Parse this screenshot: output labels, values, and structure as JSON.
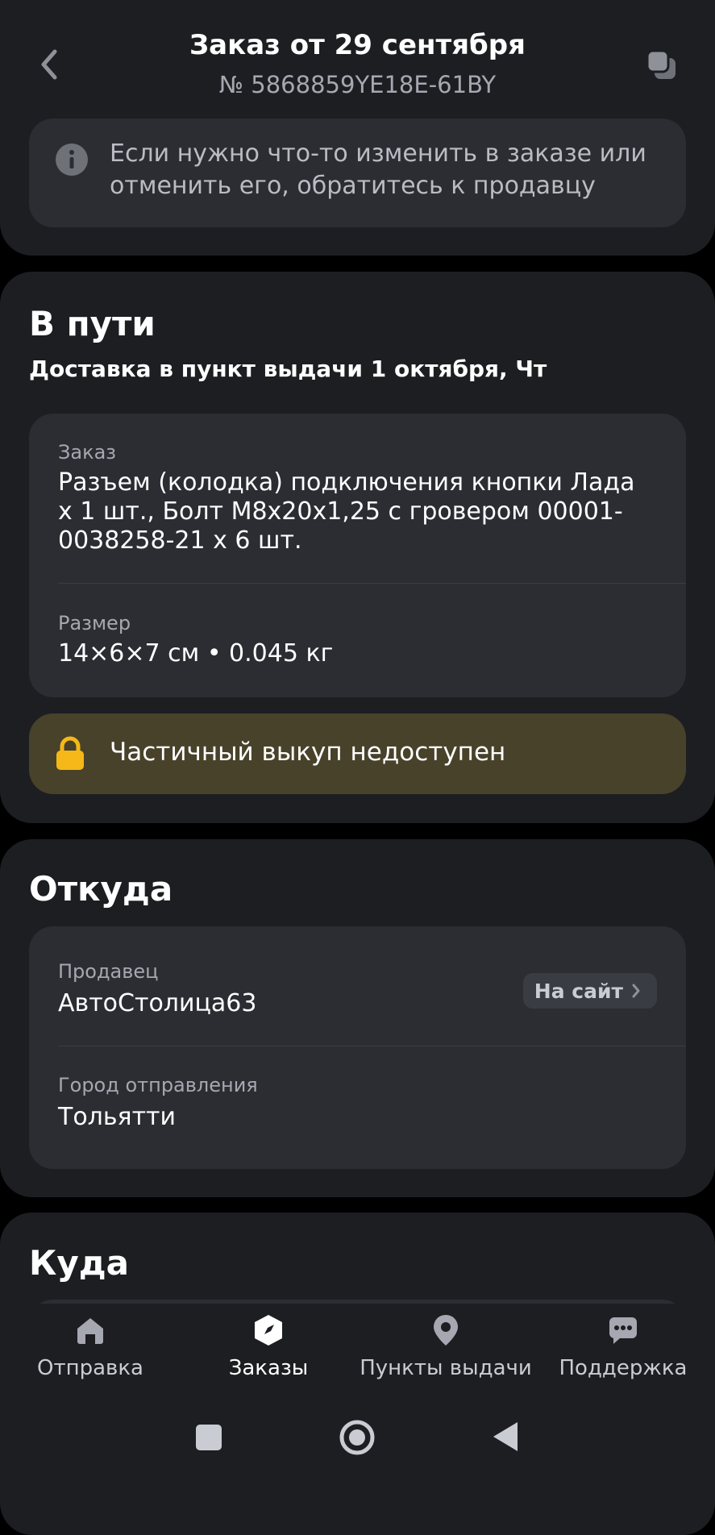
{
  "header": {
    "title": "Заказ от 29 сентября",
    "order_number": "№ 5868859YE18E-61BY",
    "back_icon": "chevron-left-icon",
    "copy_icon": "copy-icon"
  },
  "notice": {
    "icon": "info-icon",
    "text": "Если нужно что-то изменить в заказе или отменить его, обратитесь к продавцу"
  },
  "status": {
    "title": "В пути",
    "delivery": "Доставка в пункт выдачи 1 октября, Чт",
    "order_label": "Заказ",
    "order_value": "Разъем (колодка) подключения кнопки Лада x 1 шт., Болт M8x20x1,25 с гровером 00001-0038258-21 x 6 шт.",
    "size_label": "Размер",
    "size_value": "14×6×7 см • 0.045 кг",
    "partial_icon": "lock-icon",
    "partial_text": "Частичный выкуп недоступен"
  },
  "from": {
    "title": "Откуда",
    "seller_label": "Продавец",
    "seller_value": "АвтоСтолица63",
    "site_button": "На сайт",
    "city_label": "Город отправления",
    "city_value": "Тольятти"
  },
  "to": {
    "title": "Куда"
  },
  "nav": {
    "items": [
      {
        "label": "Отправка",
        "icon": "home-icon"
      },
      {
        "label": "Заказы",
        "icon": "box-icon"
      },
      {
        "label": "Пункты выдачи",
        "icon": "map-pin-icon"
      },
      {
        "label": "Поддержка",
        "icon": "chat-icon"
      }
    ],
    "active": "Заказы"
  },
  "colors": {
    "background": "#000000",
    "card": "#1d1e22",
    "inner": "#2b2d33",
    "warning_bg": "#48422a",
    "warning_icon": "#f5b818"
  }
}
